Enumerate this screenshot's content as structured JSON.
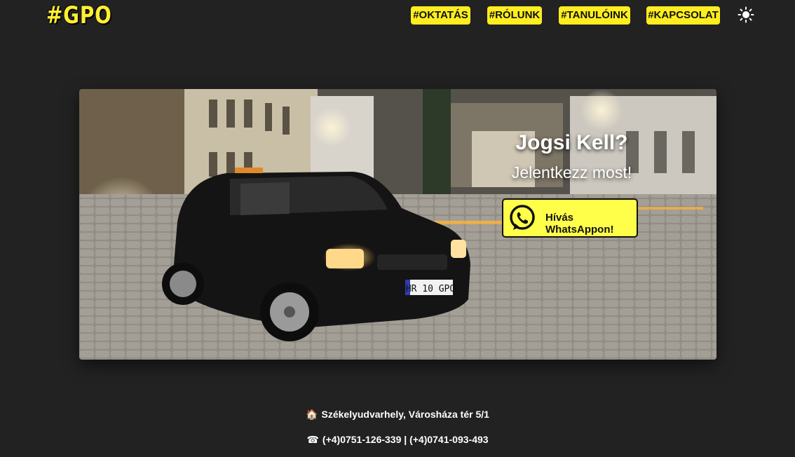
{
  "header": {
    "logo": "#GPO",
    "nav": [
      {
        "label": "#OKTATÁS"
      },
      {
        "label": "#RÓLUNK"
      },
      {
        "label": "#TANULÓINK"
      },
      {
        "label": "#KAPCSOLAT"
      }
    ],
    "theme_toggle_icon": "sun-icon"
  },
  "hero": {
    "title": "Jogsi Kell?",
    "subtitle": "Jelentkezz most!",
    "cta": {
      "label": "Hívás WhatsAppon!",
      "icon": "whatsapp-icon"
    },
    "license_plate": "HR 10 GPO"
  },
  "footer": {
    "address_icon": "house-icon",
    "address": "Székelyudvarhely, Városháza tér 5/1",
    "phone_icon": "telephone-icon",
    "phones": "(+4)0751-126-339 | (+4)0741-093-493"
  },
  "colors": {
    "background": "#222222",
    "accent": "#ffee1f",
    "cta_background": "#ffff4a"
  }
}
